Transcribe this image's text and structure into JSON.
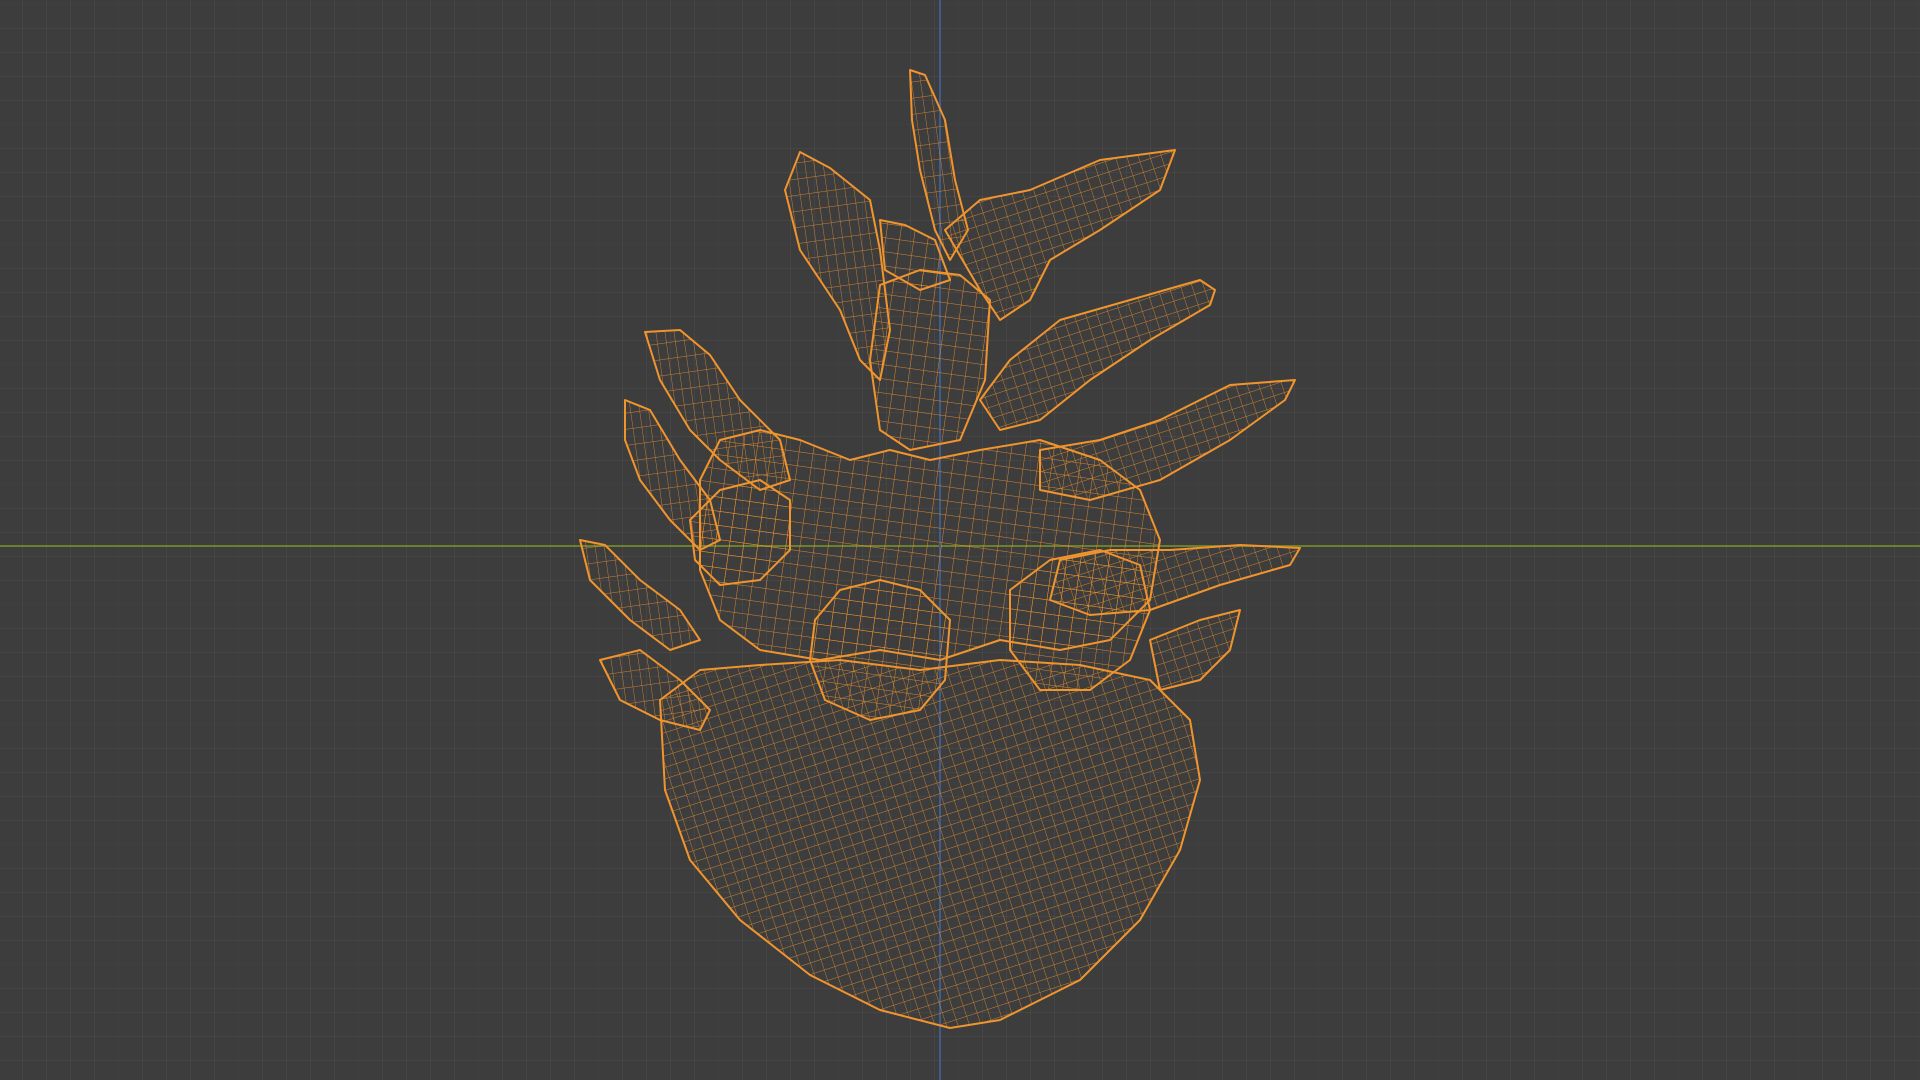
{
  "viewport": {
    "background_color": "#3d3d3d",
    "x_axis_color": "#6b7f2d",
    "y_axis_color": "#3f5c8a",
    "wireframe_color": "#f0942e",
    "object": "pineapple-crown-mesh"
  }
}
